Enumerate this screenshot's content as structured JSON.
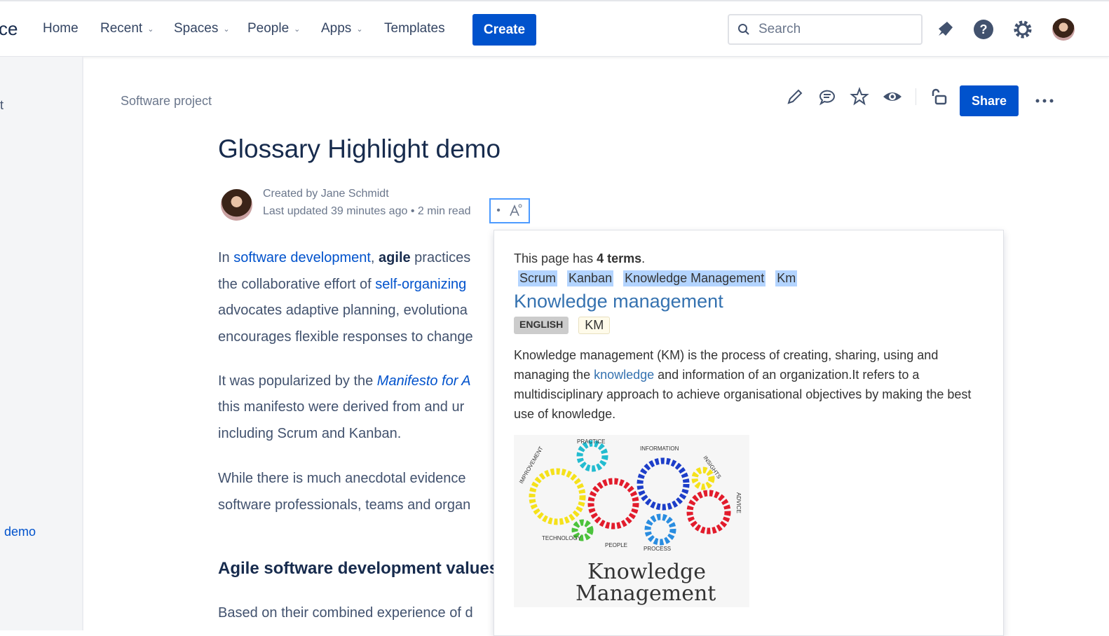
{
  "topbar": {
    "logo_partial": "ce",
    "nav": [
      {
        "label": "Home",
        "dropdown": false
      },
      {
        "label": "Recent",
        "dropdown": true
      },
      {
        "label": "Spaces",
        "dropdown": true
      },
      {
        "label": "People",
        "dropdown": true
      },
      {
        "label": "Apps",
        "dropdown": true
      },
      {
        "label": "Templates",
        "dropdown": false
      }
    ],
    "create": "Create",
    "search_placeholder": "Search"
  },
  "sidebar": {
    "item_partial": "t",
    "page_partial": "demo"
  },
  "breadcrumb": "Software project",
  "actions": {
    "share": "Share"
  },
  "page": {
    "title": "Glossary Highlight demo",
    "created_by": "Created by Jane Schmidt",
    "last_updated": "Last updated 39 minutes ago",
    "read_time": "2 min read",
    "sep": "•"
  },
  "body": {
    "p1": [
      {
        "t": "In "
      },
      {
        "t": "software development",
        "link": true
      },
      {
        "t": ", "
      },
      {
        "t": "agile",
        "bold": true
      },
      {
        "t": " practices"
      }
    ],
    "p1_l2a": "the collaborative effort of ",
    "p1_l2b": "self-organizing",
    "p1_l3": "advocates adaptive planning, evolutiona",
    "p1_l4": "encourages flexible responses to change",
    "p2_l1a": "It was popularized by the ",
    "p2_l1b": "Manifesto for A",
    "p2_l2": "this manifesto were derived from and ur",
    "p2_l3": "including Scrum and Kanban.",
    "p3_l1": "While there is much anecdotal evidence",
    "p3_l2": "software professionals, teams and organ",
    "h2": "Agile software development values",
    "p4_l1": "Based on their combined experience of d"
  },
  "popup": {
    "intro": "This page has ",
    "count": "4 terms",
    "period": ".",
    "terms": [
      "Scrum",
      "Kanban",
      "Knowledge Management",
      "Km"
    ],
    "title": "Knowledge management",
    "language": "ENGLISH",
    "abbr": "KM",
    "desc_a": "Knowledge management (KM) is the process of creating, sharing, using and managing the ",
    "desc_link": "knowledge",
    "desc_b": " and information of an organization.It refers to a multidisciplinary approach to achieve organisational objectives by making the best use of knowledge.",
    "image_text": [
      "Knowledge",
      "Management"
    ],
    "image_labels": [
      "PRACTICE",
      "INFORMATION",
      "INSIGHTS",
      "IMPROVEMENT",
      "ADVICE",
      "TECHNOLOGY",
      "PEOPLE",
      "PROCESS"
    ]
  }
}
